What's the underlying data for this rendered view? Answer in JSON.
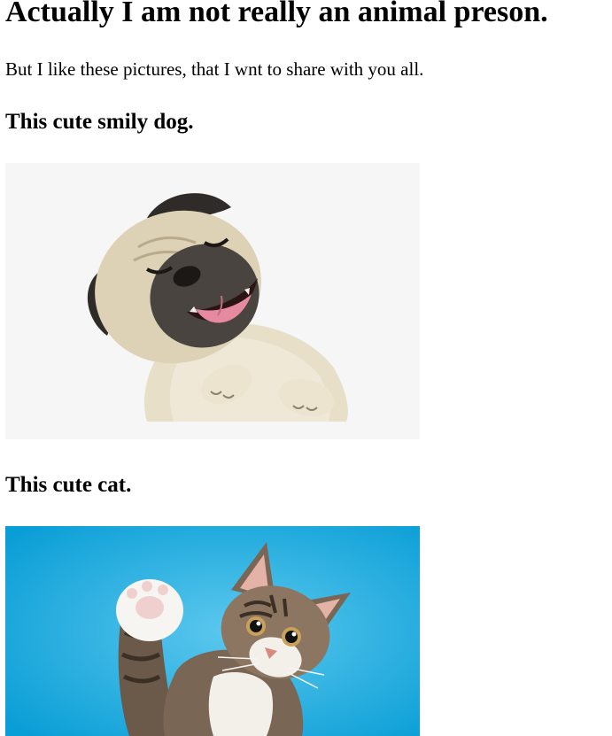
{
  "page": {
    "heading": "Actually I am not really an animal preson.",
    "intro": "But I like these pictures, that I wnt to share with you all."
  },
  "sections": [
    {
      "title": "This cute smily dog.",
      "image_icon": "smiling-pug-photo"
    },
    {
      "title": "This cute cat.",
      "image_icon": "waving-tabby-cat-photo"
    }
  ],
  "colors": {
    "text": "#000000",
    "dog_photo_background": "#f6f6f6",
    "cat_photo_background": "#12a7dc"
  }
}
